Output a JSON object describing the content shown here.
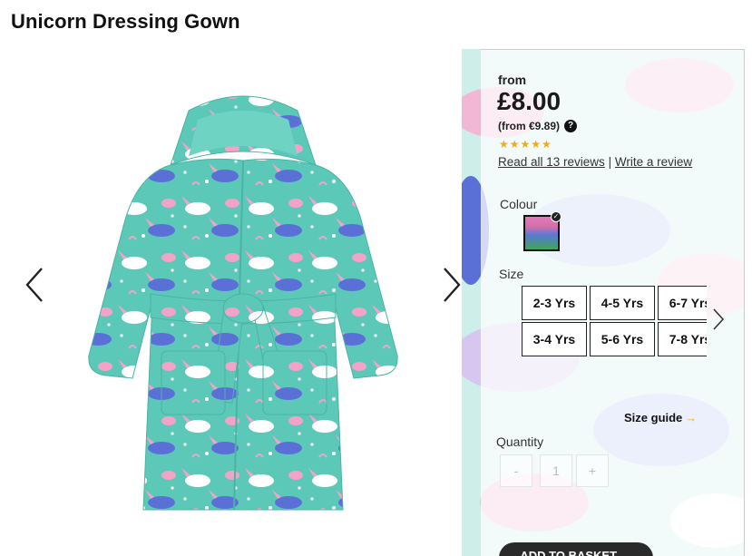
{
  "product": {
    "title": "Unicorn Dressing Gown"
  },
  "pricing": {
    "from_label": "from",
    "price": "£8.00",
    "alt_price": "(from €9.89)",
    "help_icon": "question-circle-icon",
    "help_glyph": "?"
  },
  "rating": {
    "stars_display": "★★★★★",
    "stars": 5,
    "read_reviews": "Read all 13 reviews",
    "separator": "|",
    "write_review": "Write a review"
  },
  "colour": {
    "label": "Colour",
    "selected_check": "✓"
  },
  "size": {
    "label": "Size",
    "options": [
      "2-3 Yrs",
      "4-5 Yrs",
      "6-7 Yrs",
      "3-4 Yrs",
      "5-6 Yrs",
      "7-8 Yrs"
    ],
    "guide_label": "Size guide",
    "guide_arrow": "→"
  },
  "quantity": {
    "label": "Quantity",
    "minus": "-",
    "value": "1",
    "plus": "+"
  },
  "basket": {
    "label": "ADD TO BASKET →"
  },
  "colors": {
    "accent": "#f0a81c",
    "dark": "#2a2a2a",
    "gown_base": "#5cc9b8"
  }
}
